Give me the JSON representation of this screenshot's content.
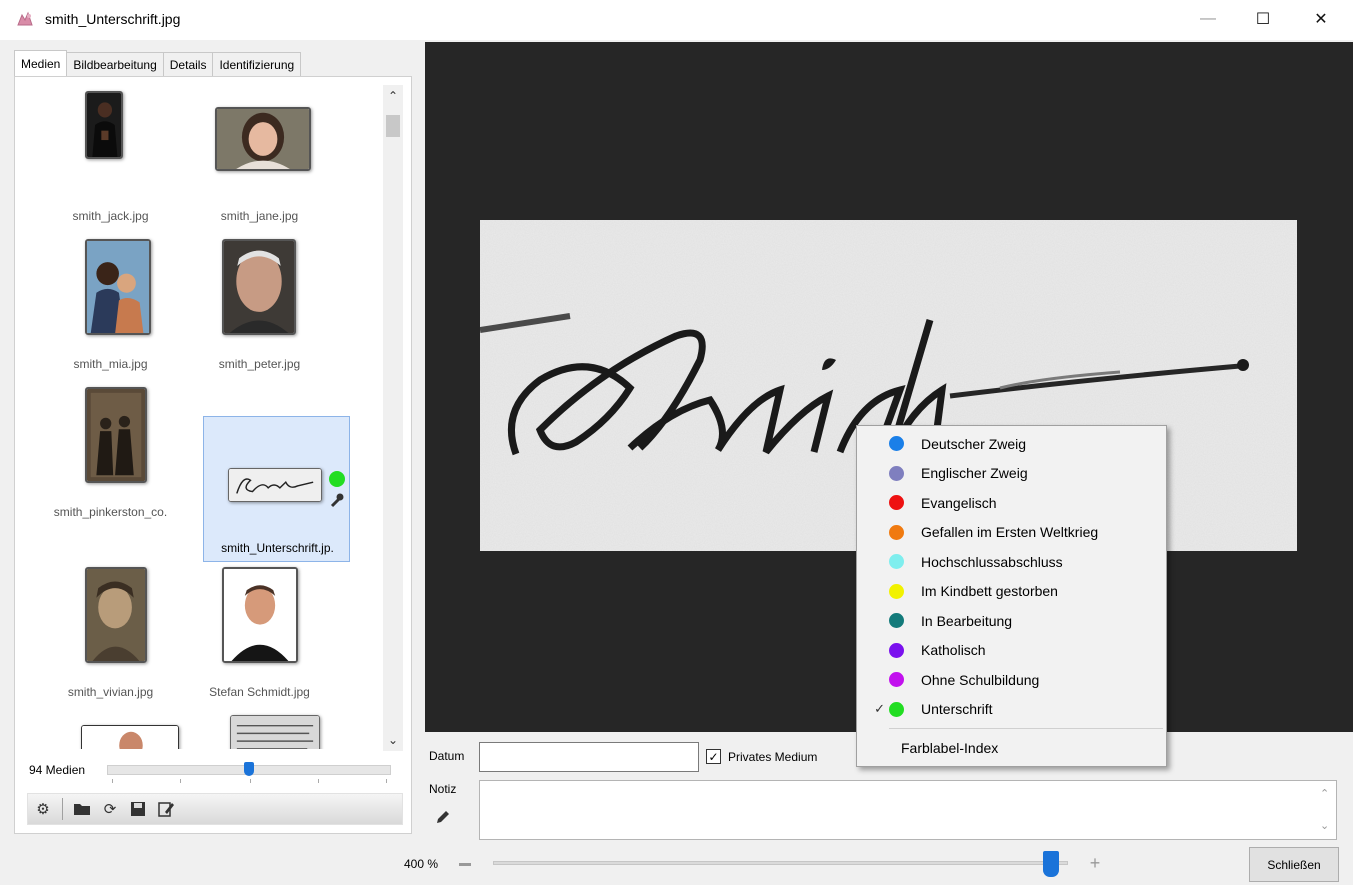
{
  "window": {
    "title": "smith_Unterschrift.jpg",
    "minimize": "—",
    "maximize": "☐",
    "close": "✕"
  },
  "tabs": [
    {
      "label": "Medien",
      "active": true
    },
    {
      "label": "Bildbearbeitung",
      "active": false
    },
    {
      "label": "Details",
      "active": false
    },
    {
      "label": "Identifizierung",
      "active": false
    }
  ],
  "media": [
    {
      "label": "smith_jack.jpg",
      "selected": false
    },
    {
      "label": "smith_jane.jpg",
      "selected": false
    },
    {
      "label": "smith_mia.jpg",
      "selected": false
    },
    {
      "label": "smith_peter.jpg",
      "selected": false
    },
    {
      "label": "smith_pinkerston_co.",
      "selected": false
    },
    {
      "label": "smith_Unterschrift.jp.",
      "selected": true,
      "color_label": "#22dd22"
    },
    {
      "label": "smith_vivian.jpg",
      "selected": false
    },
    {
      "label": "Stefan Schmidt.jpg",
      "selected": false
    },
    {
      "label": "",
      "selected": false
    },
    {
      "label": "",
      "selected": false
    }
  ],
  "scroll": {
    "up": "⌃",
    "down": "⌄"
  },
  "media_count": "94 Medien",
  "thumb_size_level": 0.5,
  "toolbar_icons": [
    "gear-icon",
    "folder-icon",
    "refresh-icon",
    "save-icon",
    "edit-icon"
  ],
  "fields": {
    "datum_label": "Datum",
    "datum_value": "",
    "private_label": "Privates Medium",
    "private_checked": "✓",
    "notiz_label": "Notiz",
    "notiz_value": ""
  },
  "zoom": {
    "label": "400 %",
    "level": 0.97
  },
  "close_button": "Schließen",
  "color_menu": {
    "items": [
      {
        "label": "Deutscher Zweig",
        "color": "#1a7fe8",
        "checked": false
      },
      {
        "label": "Englischer Zweig",
        "color": "#7f7fbf",
        "checked": false
      },
      {
        "label": "Evangelisch",
        "color": "#ee1111",
        "checked": false
      },
      {
        "label": "Gefallen im Ersten Weltkrieg",
        "color": "#f07a10",
        "checked": false
      },
      {
        "label": "Hochschlussabschluss",
        "color": "#7feeee",
        "checked": false
      },
      {
        "label": "Im Kindbett gestorben",
        "color": "#f2f200",
        "checked": false
      },
      {
        "label": "In Bearbeitung",
        "color": "#137a7a",
        "checked": false
      },
      {
        "label": "Katholisch",
        "color": "#7a11ee",
        "checked": false
      },
      {
        "label": "Ohne Schulbildung",
        "color": "#c211ee",
        "checked": false
      },
      {
        "label": "Unterschrift",
        "color": "#22dd22",
        "checked": true
      }
    ],
    "check_mark": "✓",
    "footer": "Farblabel-Index"
  }
}
